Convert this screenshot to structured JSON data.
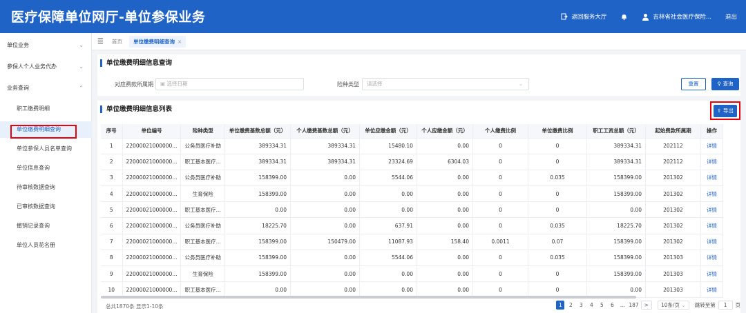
{
  "header": {
    "title": "医疗保障单位网厅-单位参保业务",
    "back_label": "返回服务大厅",
    "user_label": "吉林省社会医疗保险...",
    "logout_label": "退出",
    "bg_color": "#1f63c6"
  },
  "sidebar": {
    "groups": [
      {
        "label": "单位业务",
        "expanded": false
      },
      {
        "label": "参保人个人业务代办",
        "expanded": false
      },
      {
        "label": "业务查询",
        "expanded": true
      }
    ],
    "items": [
      {
        "label": "职工缴费明细"
      },
      {
        "label": "单位缴费明细查询",
        "active": true
      },
      {
        "label": "单位参保人员名单查询"
      },
      {
        "label": "单位信息查询"
      },
      {
        "label": "待审核数据查询"
      },
      {
        "label": "已审核数据查询"
      },
      {
        "label": "撤销记录查询"
      },
      {
        "label": "单位人员花名册"
      }
    ]
  },
  "tabs": {
    "home": "首页",
    "active": "单位缴费明细查询",
    "close": "×"
  },
  "query": {
    "title": "单位缴费明细信息查询",
    "period_label": "对应费款所属期",
    "period_placeholder": "选择日期",
    "type_label": "险种类型",
    "type_placeholder": "请选择",
    "reset_label": "重置",
    "search_label": "查询"
  },
  "list": {
    "title": "单位缴费明细信息列表",
    "export_label": "导出",
    "columns": [
      "序号",
      "单位编号",
      "险种类型",
      "单位缴费基数总额（元）",
      "个人缴费基数总额（元）",
      "单位应缴金额（元）",
      "个人应缴金额（元）",
      "个人缴费比例",
      "单位缴费比例",
      "职工工资总额（元）",
      "起始费款所属期",
      "操作"
    ],
    "rows": [
      [
        "1",
        "22000021000000...",
        "公务员医疗补助",
        "389334.31",
        "389334.31",
        "15480.10",
        "0.00",
        "0",
        "0",
        "389334.31",
        "202112",
        "详情"
      ],
      [
        "2",
        "22000021000000...",
        "职工基本医疗...",
        "389334.31",
        "389334.31",
        "23324.69",
        "6304.03",
        "0",
        "0",
        "389334.31",
        "202112",
        "详情"
      ],
      [
        "3",
        "22000021000000...",
        "公务员医疗补助",
        "158399.00",
        "0.00",
        "5544.06",
        "0.00",
        "0",
        "0.035",
        "158399.00",
        "201302",
        "详情"
      ],
      [
        "4",
        "22000021000000...",
        "生育保险",
        "158399.00",
        "0.00",
        "0.00",
        "0.00",
        "0",
        "0",
        "158399.00",
        "201302",
        "详情"
      ],
      [
        "5",
        "22000021000000...",
        "职工基本医疗...",
        "0.00",
        "0.00",
        "0.00",
        "0.00",
        "0",
        "0",
        "0.00",
        "201302",
        "详情"
      ],
      [
        "6",
        "22000021000000...",
        "公务员医疗补助",
        "18225.70",
        "0.00",
        "637.91",
        "0.00",
        "0",
        "0.035",
        "18225.70",
        "201302",
        "详情"
      ],
      [
        "7",
        "22000021000000...",
        "职工基本医疗...",
        "158399.00",
        "150479.00",
        "11087.93",
        "158.40",
        "0.0011",
        "0.07",
        "158399.00",
        "201302",
        "详情"
      ],
      [
        "8",
        "22000021000000...",
        "公务员医疗补助",
        "158399.00",
        "0.00",
        "5544.06",
        "0.00",
        "0",
        "0.035",
        "158399.00",
        "201303",
        "详情"
      ],
      [
        "9",
        "22000021000000...",
        "生育保险",
        "158399.00",
        "0.00",
        "0.00",
        "0.00",
        "0",
        "0",
        "158399.00",
        "201303",
        "详情"
      ],
      [
        "10",
        "22000021000000...",
        "职工基本医疗...",
        "0.00",
        "0.00",
        "0.00",
        "0.00",
        "0",
        "0",
        "0.00",
        "201303",
        "详情"
      ]
    ]
  },
  "footer": {
    "total_text": "总共1870条 显示1-10条",
    "pages": [
      "1",
      "2",
      "3",
      "4",
      "5",
      "6",
      "...",
      "187"
    ],
    "current_page": "1",
    "next": ">",
    "page_size": "10条/页",
    "jump_label": "跳转至第",
    "jump_value": "1",
    "jump_unit": "页"
  }
}
